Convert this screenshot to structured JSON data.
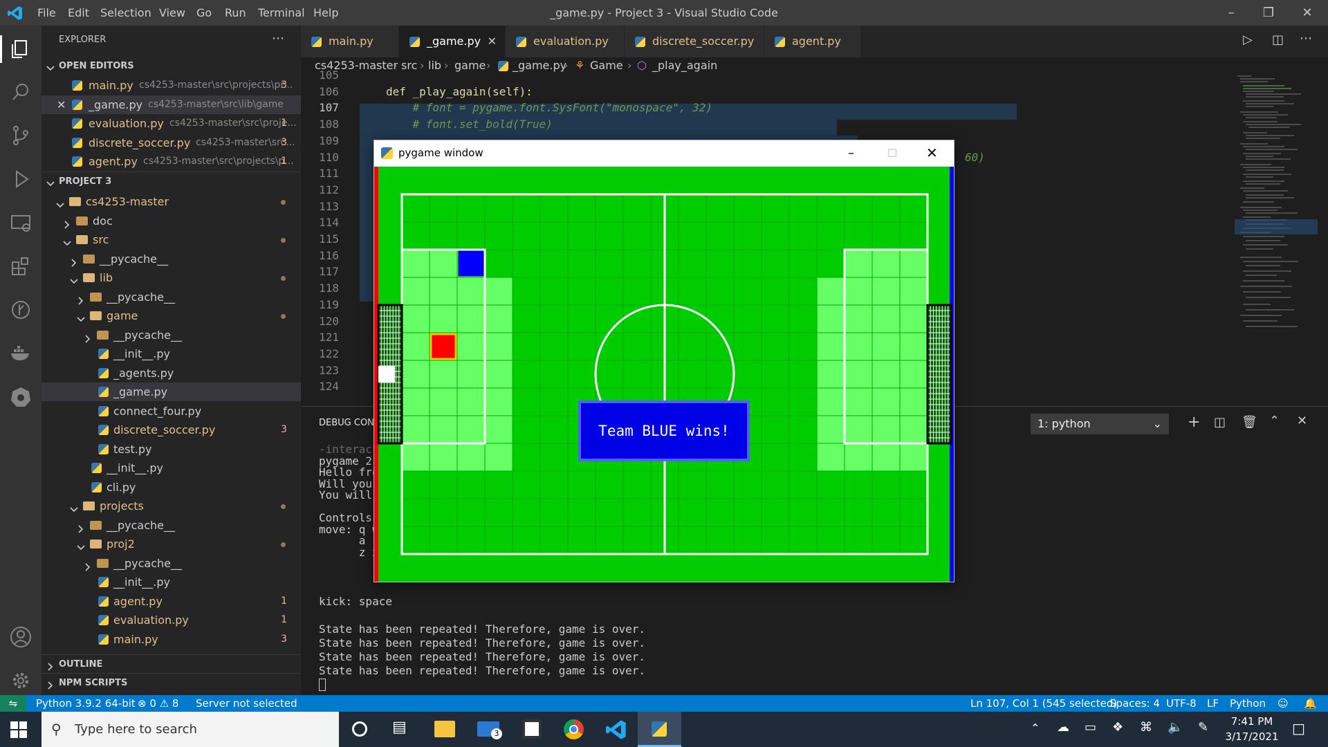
{
  "titlebar": {
    "menu": [
      "File",
      "Edit",
      "Selection",
      "View",
      "Go",
      "Run",
      "Terminal",
      "Help"
    ],
    "title": "_game.py - Project 3 - Visual Studio Code"
  },
  "sidebar": {
    "explorer_label": "EXPLORER",
    "open_editors_label": "OPEN EDITORS",
    "open_editors": [
      {
        "name": "main.py",
        "path": "cs4253-master\\src\\projects\\pr...",
        "badge": "3"
      },
      {
        "name": "_game.py",
        "path": "cs4253-master\\src\\lib\\game",
        "badge": ""
      },
      {
        "name": "evaluation.py",
        "path": "cs4253-master\\src\\proje...",
        "badge": "1"
      },
      {
        "name": "discrete_soccer.py",
        "path": "cs4253-master\\src...",
        "badge": "3"
      },
      {
        "name": "agent.py",
        "path": "cs4253-master\\src\\projects\\p...",
        "badge": "1"
      }
    ],
    "project_label": "PROJECT 3",
    "tree": [
      {
        "name": "cs4253-master",
        "type": "folder",
        "depth": 0,
        "open": true,
        "dot": true
      },
      {
        "name": "doc",
        "type": "folder",
        "depth": 1,
        "open": false
      },
      {
        "name": "src",
        "type": "folder",
        "depth": 1,
        "open": true,
        "dot": true
      },
      {
        "name": "__pycache__",
        "type": "folder",
        "depth": 2,
        "open": false
      },
      {
        "name": "lib",
        "type": "folder",
        "depth": 2,
        "open": true,
        "dot": true
      },
      {
        "name": "__pycache__",
        "type": "folder",
        "depth": 3,
        "open": false
      },
      {
        "name": "game",
        "type": "folder",
        "depth": 3,
        "open": true,
        "dot": true
      },
      {
        "name": "__pycache__",
        "type": "folder",
        "depth": 4,
        "open": false
      },
      {
        "name": "__init__.py",
        "type": "py",
        "depth": 4
      },
      {
        "name": "_agents.py",
        "type": "py",
        "depth": 4
      },
      {
        "name": "_game.py",
        "type": "py",
        "depth": 4,
        "selected": true
      },
      {
        "name": "connect_four.py",
        "type": "py",
        "depth": 4
      },
      {
        "name": "discrete_soccer.py",
        "type": "py",
        "depth": 4,
        "badge": "3"
      },
      {
        "name": "test.py",
        "type": "py",
        "depth": 4
      },
      {
        "name": "__init__.py",
        "type": "py",
        "depth": 3
      },
      {
        "name": "cli.py",
        "type": "py",
        "depth": 3
      },
      {
        "name": "projects",
        "type": "folder",
        "depth": 2,
        "open": true,
        "dot": true
      },
      {
        "name": "__pycache__",
        "type": "folder",
        "depth": 3,
        "open": false
      },
      {
        "name": "proj2",
        "type": "folder",
        "depth": 3,
        "open": true,
        "dot": true
      },
      {
        "name": "__pycache__",
        "type": "folder",
        "depth": 4,
        "open": false
      },
      {
        "name": "__init__.py",
        "type": "py",
        "depth": 4
      },
      {
        "name": "agent.py",
        "type": "py",
        "depth": 4,
        "badge": "1"
      },
      {
        "name": "evaluation.py",
        "type": "py",
        "depth": 4,
        "badge": "1"
      },
      {
        "name": "main.py",
        "type": "py",
        "depth": 4,
        "badge": "3"
      }
    ],
    "outline_label": "OUTLINE",
    "npm_label": "NPM SCRIPTS"
  },
  "tabs": [
    {
      "label": "main.py",
      "active": false
    },
    {
      "label": "_game.py",
      "active": true
    },
    {
      "label": "evaluation.py",
      "active": false
    },
    {
      "label": "discrete_soccer.py",
      "active": false
    },
    {
      "label": "agent.py",
      "active": false
    }
  ],
  "breadcrumb": [
    "cs4253-master",
    "src",
    "lib",
    "game",
    "_game.py",
    "Game",
    "_play_again"
  ],
  "editor": {
    "lines": [
      {
        "n": "105",
        "text": ""
      },
      {
        "n": "106",
        "text": "def _play_again(self):"
      },
      {
        "n": "107",
        "text": "    # font = pygame.font.SysFont(\"monospace\", 32)"
      },
      {
        "n": "108",
        "text": "    # font.set_bold(True)"
      },
      {
        "n": "109",
        "text": ""
      },
      {
        "n": "110",
        "text": "60)"
      },
      {
        "n": "111",
        "text": ""
      },
      {
        "n": "112",
        "text": ""
      },
      {
        "n": "113",
        "text": ""
      },
      {
        "n": "114",
        "text": ""
      },
      {
        "n": "115",
        "text": ""
      },
      {
        "n": "116",
        "text": ""
      },
      {
        "n": "117",
        "text": ""
      },
      {
        "n": "118",
        "text": ""
      },
      {
        "n": "119",
        "text": ""
      },
      {
        "n": "120",
        "text": ""
      },
      {
        "n": "121",
        "text": ""
      },
      {
        "n": "122",
        "text": ""
      },
      {
        "n": "123",
        "text": ""
      },
      {
        "n": "124",
        "text": ""
      }
    ],
    "current_line": "107"
  },
  "panel": {
    "tab_label": "DEBUG CONS",
    "terminal_select": "1: python",
    "lines_left": [
      "-interact",
      "pygame 2.",
      "Hello fro",
      "Will you",
      "You will",
      "",
      "Controls:",
      "move: q w",
      "      a",
      "      z x"
    ],
    "lines_bottom": [
      "kick: space",
      "",
      "State has been repeated! Therefore, game is over.",
      "State has been repeated! Therefore, game is over.",
      "State has been repeated! Therefore, game is over.",
      "State has been repeated! Therefore, game is over."
    ]
  },
  "statusbar": {
    "python": "Python 3.9.2 64-bit",
    "problems": "⊗ 0 ⚠ 8",
    "server": "Server not selected",
    "position": "Ln 107, Col 1 (545 selected)",
    "spaces": "Spaces: 4",
    "encoding": "UTF-8",
    "eol": "LF",
    "language": "Python"
  },
  "taskbar": {
    "search_placeholder": "Type here to search",
    "time": "7:41 PM",
    "date": "3/17/2021",
    "mail_badge": "3"
  },
  "pygame": {
    "title": "pygame window",
    "message": "Team BLUE wins!"
  },
  "colors": {
    "accent": "#007acc",
    "field": "#00cc00",
    "field_light": "#66ff66",
    "blue_team": "#0000ff",
    "red_team": "#ff0000"
  }
}
